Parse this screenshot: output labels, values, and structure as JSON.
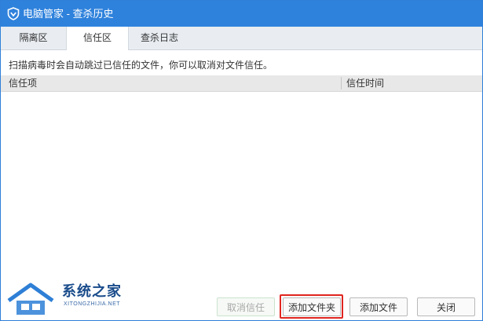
{
  "window": {
    "title": "电脑管家 - 查杀历史",
    "accent": "#2f82dc"
  },
  "tabs": [
    {
      "label": "隔离区",
      "active": false
    },
    {
      "label": "信任区",
      "active": true
    },
    {
      "label": "查杀日志",
      "active": false
    }
  ],
  "hint": "扫描病毒时会自动跳过已信任的文件，你可以取消对文件信任。",
  "table": {
    "columns": [
      "信任项",
      "信任时间"
    ],
    "rows": []
  },
  "buttons": {
    "cancel_trust": "取消信任",
    "add_folder": "添加文件夹",
    "add_file": "添加文件",
    "close": "关闭"
  },
  "watermark": {
    "text": "系统之家",
    "sub": "XITONGZHIJIA.NET"
  },
  "colors": {
    "highlight": "#e0251f"
  }
}
